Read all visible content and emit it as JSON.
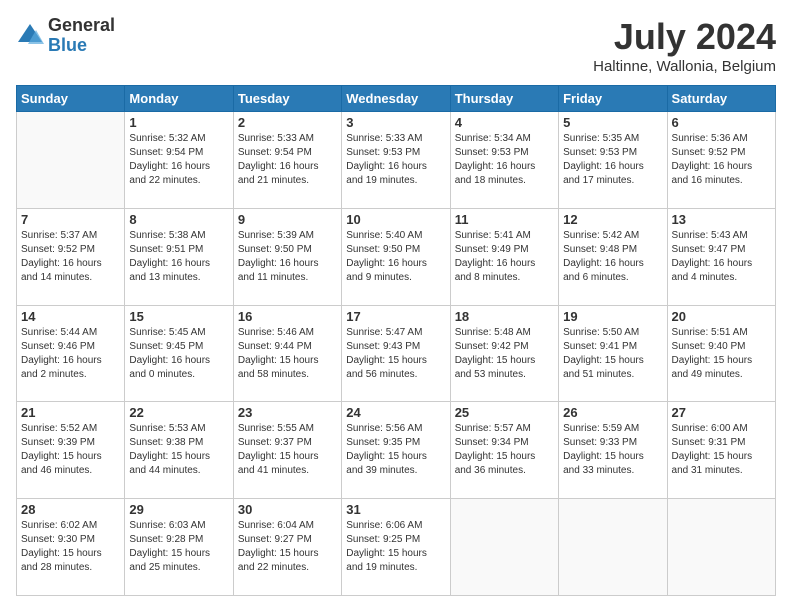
{
  "logo": {
    "general": "General",
    "blue": "Blue"
  },
  "title": {
    "month": "July 2024",
    "location": "Haltinne, Wallonia, Belgium"
  },
  "weekdays": [
    "Sunday",
    "Monday",
    "Tuesday",
    "Wednesday",
    "Thursday",
    "Friday",
    "Saturday"
  ],
  "weeks": [
    [
      {
        "day": "",
        "info": ""
      },
      {
        "day": "1",
        "info": "Sunrise: 5:32 AM\nSunset: 9:54 PM\nDaylight: 16 hours\nand 22 minutes."
      },
      {
        "day": "2",
        "info": "Sunrise: 5:33 AM\nSunset: 9:54 PM\nDaylight: 16 hours\nand 21 minutes."
      },
      {
        "day": "3",
        "info": "Sunrise: 5:33 AM\nSunset: 9:53 PM\nDaylight: 16 hours\nand 19 minutes."
      },
      {
        "day": "4",
        "info": "Sunrise: 5:34 AM\nSunset: 9:53 PM\nDaylight: 16 hours\nand 18 minutes."
      },
      {
        "day": "5",
        "info": "Sunrise: 5:35 AM\nSunset: 9:53 PM\nDaylight: 16 hours\nand 17 minutes."
      },
      {
        "day": "6",
        "info": "Sunrise: 5:36 AM\nSunset: 9:52 PM\nDaylight: 16 hours\nand 16 minutes."
      }
    ],
    [
      {
        "day": "7",
        "info": "Sunrise: 5:37 AM\nSunset: 9:52 PM\nDaylight: 16 hours\nand 14 minutes."
      },
      {
        "day": "8",
        "info": "Sunrise: 5:38 AM\nSunset: 9:51 PM\nDaylight: 16 hours\nand 13 minutes."
      },
      {
        "day": "9",
        "info": "Sunrise: 5:39 AM\nSunset: 9:50 PM\nDaylight: 16 hours\nand 11 minutes."
      },
      {
        "day": "10",
        "info": "Sunrise: 5:40 AM\nSunset: 9:50 PM\nDaylight: 16 hours\nand 9 minutes."
      },
      {
        "day": "11",
        "info": "Sunrise: 5:41 AM\nSunset: 9:49 PM\nDaylight: 16 hours\nand 8 minutes."
      },
      {
        "day": "12",
        "info": "Sunrise: 5:42 AM\nSunset: 9:48 PM\nDaylight: 16 hours\nand 6 minutes."
      },
      {
        "day": "13",
        "info": "Sunrise: 5:43 AM\nSunset: 9:47 PM\nDaylight: 16 hours\nand 4 minutes."
      }
    ],
    [
      {
        "day": "14",
        "info": "Sunrise: 5:44 AM\nSunset: 9:46 PM\nDaylight: 16 hours\nand 2 minutes."
      },
      {
        "day": "15",
        "info": "Sunrise: 5:45 AM\nSunset: 9:45 PM\nDaylight: 16 hours\nand 0 minutes."
      },
      {
        "day": "16",
        "info": "Sunrise: 5:46 AM\nSunset: 9:44 PM\nDaylight: 15 hours\nand 58 minutes."
      },
      {
        "day": "17",
        "info": "Sunrise: 5:47 AM\nSunset: 9:43 PM\nDaylight: 15 hours\nand 56 minutes."
      },
      {
        "day": "18",
        "info": "Sunrise: 5:48 AM\nSunset: 9:42 PM\nDaylight: 15 hours\nand 53 minutes."
      },
      {
        "day": "19",
        "info": "Sunrise: 5:50 AM\nSunset: 9:41 PM\nDaylight: 15 hours\nand 51 minutes."
      },
      {
        "day": "20",
        "info": "Sunrise: 5:51 AM\nSunset: 9:40 PM\nDaylight: 15 hours\nand 49 minutes."
      }
    ],
    [
      {
        "day": "21",
        "info": "Sunrise: 5:52 AM\nSunset: 9:39 PM\nDaylight: 15 hours\nand 46 minutes."
      },
      {
        "day": "22",
        "info": "Sunrise: 5:53 AM\nSunset: 9:38 PM\nDaylight: 15 hours\nand 44 minutes."
      },
      {
        "day": "23",
        "info": "Sunrise: 5:55 AM\nSunset: 9:37 PM\nDaylight: 15 hours\nand 41 minutes."
      },
      {
        "day": "24",
        "info": "Sunrise: 5:56 AM\nSunset: 9:35 PM\nDaylight: 15 hours\nand 39 minutes."
      },
      {
        "day": "25",
        "info": "Sunrise: 5:57 AM\nSunset: 9:34 PM\nDaylight: 15 hours\nand 36 minutes."
      },
      {
        "day": "26",
        "info": "Sunrise: 5:59 AM\nSunset: 9:33 PM\nDaylight: 15 hours\nand 33 minutes."
      },
      {
        "day": "27",
        "info": "Sunrise: 6:00 AM\nSunset: 9:31 PM\nDaylight: 15 hours\nand 31 minutes."
      }
    ],
    [
      {
        "day": "28",
        "info": "Sunrise: 6:02 AM\nSunset: 9:30 PM\nDaylight: 15 hours\nand 28 minutes."
      },
      {
        "day": "29",
        "info": "Sunrise: 6:03 AM\nSunset: 9:28 PM\nDaylight: 15 hours\nand 25 minutes."
      },
      {
        "day": "30",
        "info": "Sunrise: 6:04 AM\nSunset: 9:27 PM\nDaylight: 15 hours\nand 22 minutes."
      },
      {
        "day": "31",
        "info": "Sunrise: 6:06 AM\nSunset: 9:25 PM\nDaylight: 15 hours\nand 19 minutes."
      },
      {
        "day": "",
        "info": ""
      },
      {
        "day": "",
        "info": ""
      },
      {
        "day": "",
        "info": ""
      }
    ]
  ]
}
